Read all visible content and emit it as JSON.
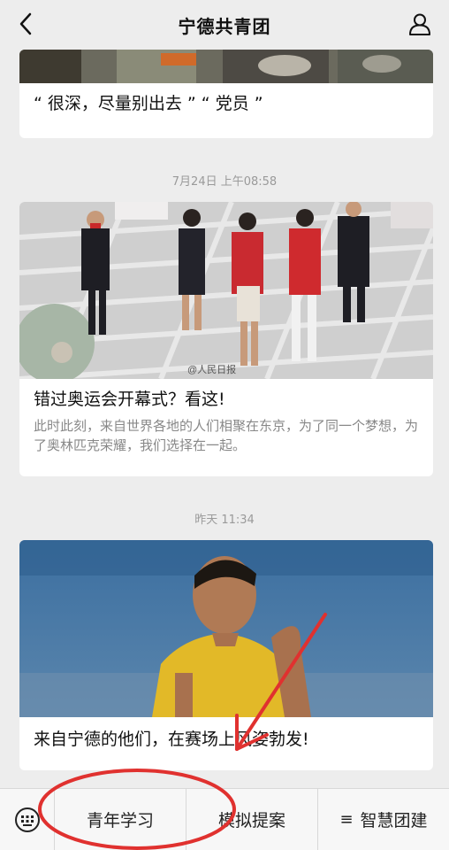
{
  "header": {
    "title": "宁德共青团",
    "back_icon": "chevron-left-icon",
    "profile_icon": "user-icon"
  },
  "articles": [
    {
      "caption": "“ 很深，尽量别出去 ” “ 党员 ”"
    },
    {
      "timestamp": "7月24日 上午08:58",
      "caption": "错过奥运会开幕式？看这!",
      "description": "此时此刻，来自世界各地的人们相聚在东京，为了同一个梦想，为了奥林匹克荣耀，我们选择在一起。",
      "image_watermark": "@人民日报"
    },
    {
      "timestamp": "昨天 11:34",
      "caption": "来自宁德的他们，在赛场上风姿勃发!"
    }
  ],
  "tabbar": {
    "keyboard_icon": "keyboard-icon",
    "tabs": [
      {
        "label": "青年学习"
      },
      {
        "label": "模拟提案"
      },
      {
        "label": "智慧团建",
        "icon": "menu-icon"
      }
    ]
  },
  "colors": {
    "background": "#ededed",
    "card": "#ffffff",
    "annotation_red": "#e0312f",
    "timestamp": "#9a9a9a"
  }
}
